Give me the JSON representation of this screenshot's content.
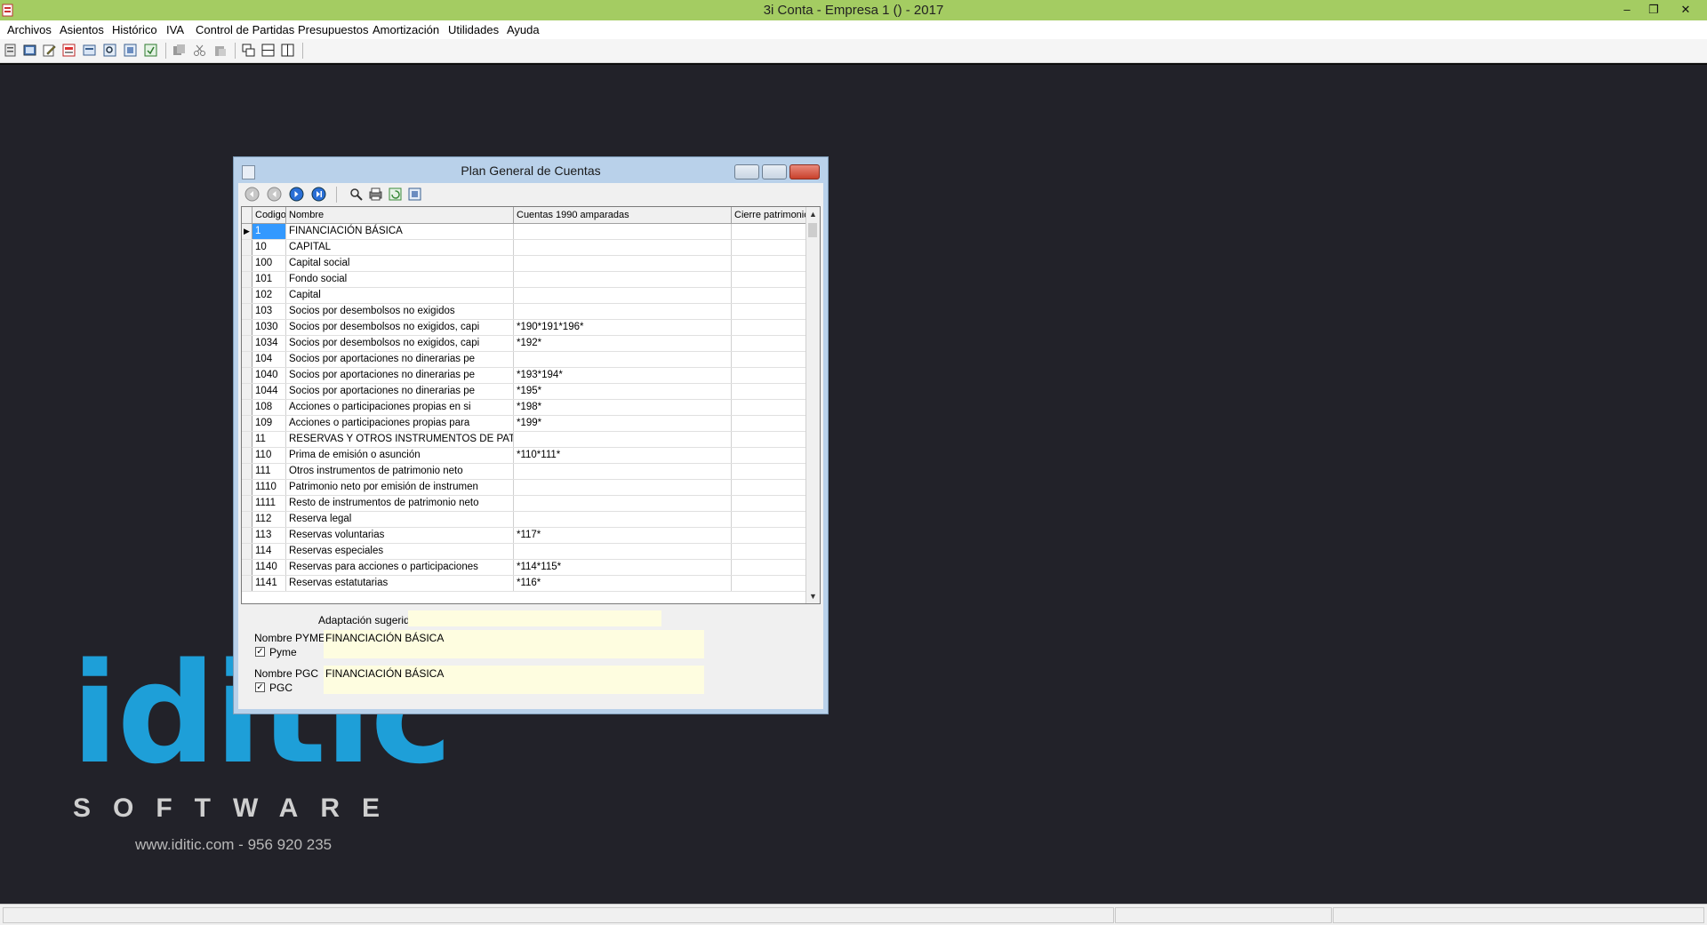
{
  "window": {
    "title": "3i Conta - Empresa 1 ()  - 2017",
    "minimize": "–",
    "restore": "❐",
    "close": "✕"
  },
  "menu": [
    "Archivos",
    "Asientos",
    "Histórico",
    "IVA",
    "Control de Partidas",
    "Presupuestos",
    "Amortización",
    "Utilidades",
    "Ayuda"
  ],
  "toolbar_icons": [
    "ledger-icon",
    "database-icon",
    "edit-icon",
    "vat-icon",
    "report-icon",
    "search-icon",
    "preview-icon",
    "export-icon",
    "copy-icon",
    "cut-icon",
    "paste-icon",
    "cascade-icon",
    "tile-horizontal-icon",
    "tile-vertical-icon"
  ],
  "child": {
    "title": "Plan General de Cuentas",
    "nav_icons": [
      "first-record-icon",
      "prev-record-icon",
      "next-record-icon",
      "last-record-icon",
      "search-icon",
      "print-icon",
      "refresh-icon",
      "export-icon"
    ],
    "columns": [
      "Codigo",
      "Nombre",
      "Cuentas 1990 amparadas",
      "Cierre patrimonio"
    ],
    "rows": [
      {
        "codigo": "1",
        "nombre": "FINANCIACIÓN BÁSICA",
        "cuentas": "",
        "cierre": ""
      },
      {
        "codigo": "10",
        "nombre": "CAPITAL",
        "cuentas": "",
        "cierre": ""
      },
      {
        "codigo": "100",
        "nombre": "Capital social",
        "cuentas": "",
        "cierre": ""
      },
      {
        "codigo": "101",
        "nombre": "Fondo social",
        "cuentas": "",
        "cierre": ""
      },
      {
        "codigo": "102",
        "nombre": "Capital",
        "cuentas": "",
        "cierre": ""
      },
      {
        "codigo": "103",
        "nombre": "Socios por desembolsos no exigidos",
        "cuentas": "",
        "cierre": ""
      },
      {
        "codigo": "1030",
        "nombre": "Socios por desembolsos no exigidos, capi",
        "cuentas": "*190*191*196*",
        "cierre": ""
      },
      {
        "codigo": "1034",
        "nombre": "Socios por desembolsos no exigidos, capi",
        "cuentas": "*192*",
        "cierre": ""
      },
      {
        "codigo": "104",
        "nombre": "Socios por aportaciones no dinerarias pe",
        "cuentas": "",
        "cierre": ""
      },
      {
        "codigo": "1040",
        "nombre": "Socios por aportaciones no dinerarias pe",
        "cuentas": "*193*194*",
        "cierre": ""
      },
      {
        "codigo": "1044",
        "nombre": "Socios por aportaciones no dinerarias pe",
        "cuentas": "*195*",
        "cierre": ""
      },
      {
        "codigo": "108",
        "nombre": "Acciones o participaciones propias en si",
        "cuentas": "*198*",
        "cierre": ""
      },
      {
        "codigo": "109",
        "nombre": "Acciones o participaciones propias para",
        "cuentas": "*199*",
        "cierre": ""
      },
      {
        "codigo": "11",
        "nombre": "RESERVAS Y OTROS INSTRUMENTOS DE PATRI",
        "cuentas": "",
        "cierre": ""
      },
      {
        "codigo": "110",
        "nombre": "Prima de emisión o asunción",
        "cuentas": "*110*111*",
        "cierre": ""
      },
      {
        "codigo": "111",
        "nombre": "Otros instrumentos de patrimonio neto",
        "cuentas": "",
        "cierre": ""
      },
      {
        "codigo": "1110",
        "nombre": "Patrimonio neto por emisión de instrumen",
        "cuentas": "",
        "cierre": ""
      },
      {
        "codigo": "1111",
        "nombre": "Resto de instrumentos de patrimonio neto",
        "cuentas": "",
        "cierre": ""
      },
      {
        "codigo": "112",
        "nombre": "Reserva legal",
        "cuentas": "",
        "cierre": ""
      },
      {
        "codigo": "113",
        "nombre": "Reservas voluntarias",
        "cuentas": "*117*",
        "cierre": ""
      },
      {
        "codigo": "114",
        "nombre": "Reservas especiales",
        "cuentas": "",
        "cierre": ""
      },
      {
        "codigo": "1140",
        "nombre": "Reservas para acciones o participaciones",
        "cuentas": "*114*115*",
        "cierre": ""
      },
      {
        "codigo": "1141",
        "nombre": "Reservas estatutarias",
        "cuentas": "*116*",
        "cierre": ""
      }
    ],
    "form": {
      "adaptacion_label": "Adaptación sugerida",
      "adaptacion_value": "",
      "pyme_name_label": "Nombre PYME",
      "pyme_name_value": "FINANCIACIÓN BÁSICA",
      "pyme_check_label": "Pyme",
      "pyme_checked": "✓",
      "pgc_name_label": "Nombre PGC",
      "pgc_name_value": "FINANCIACIÓN BÁSICA",
      "pgc_check_label": "PGC",
      "pgc_checked": "✓"
    }
  },
  "logo": {
    "word": "iditic",
    "sub": "SOFTWARE",
    "contact": "www.iditic.com  -  956 920 235"
  },
  "colors": {
    "titlebar": "#a4cc62",
    "workspace": "#222229",
    "logo_blue": "#1e9fd8",
    "selection": "#3399ff"
  }
}
